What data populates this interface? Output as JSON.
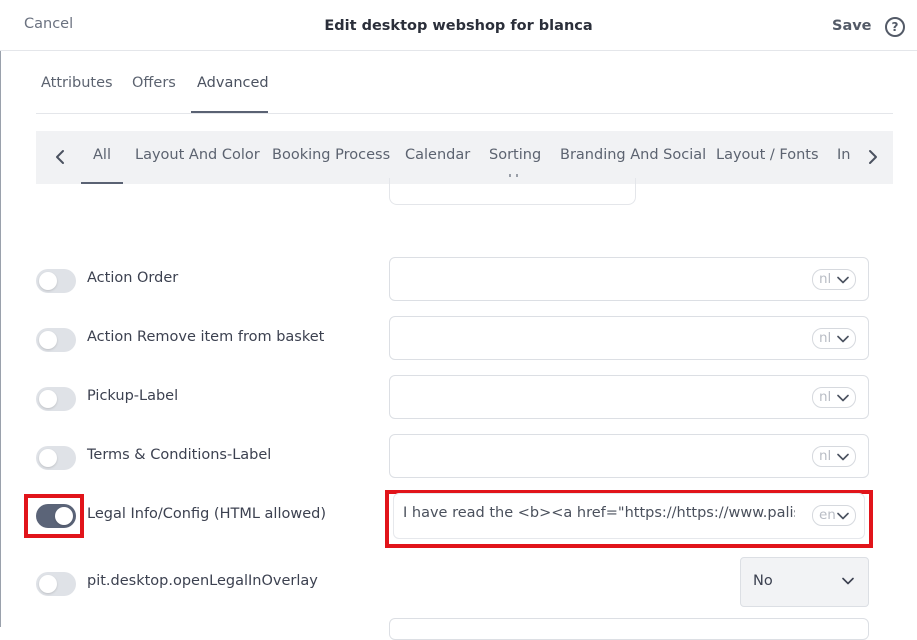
{
  "header": {
    "cancel_label": "Cancel",
    "title": "Edit desktop webshop for blanca",
    "save_label": "Save",
    "help_glyph": "?"
  },
  "main_tabs": [
    {
      "label": "Attributes",
      "active": false
    },
    {
      "label": "Offers",
      "active": false
    },
    {
      "label": "Advanced",
      "active": true
    }
  ],
  "sub_tabs": [
    {
      "label": "All",
      "active": true
    },
    {
      "label": "Layout And Color"
    },
    {
      "label": "Booking Process"
    },
    {
      "label": "Calendar"
    },
    {
      "label": "Sorting"
    },
    {
      "label": "Branding And Social"
    },
    {
      "label": "Layout / Fonts"
    },
    {
      "label": "In"
    }
  ],
  "rows": [
    {
      "label": "Action Order",
      "enabled": false,
      "value": "",
      "lang": "nl"
    },
    {
      "label": "Action Remove item from basket",
      "enabled": false,
      "value": "",
      "lang": "nl"
    },
    {
      "label": "Pickup-Label",
      "enabled": false,
      "value": "",
      "lang": "nl"
    },
    {
      "label": "Terms & Conditions-Label",
      "enabled": false,
      "value": "",
      "lang": "nl"
    },
    {
      "label": "Legal Info/Config (HTML allowed)",
      "enabled": true,
      "value": "I have read the <b><a href=\"https://https://www.palisi",
      "lang": "en"
    },
    {
      "label": "pit.desktop.openLegalInOverlay",
      "enabled": false,
      "select_value": "No"
    }
  ],
  "icons": {
    "help": "help-circle-icon",
    "prev": "chevron-left-icon",
    "next": "chevron-right-icon",
    "dropdown": "chevron-down-icon"
  },
  "colors": {
    "highlight": "#e1141a",
    "toggle_on": "#5b6478",
    "toggle_off": "#dfe2e7"
  }
}
